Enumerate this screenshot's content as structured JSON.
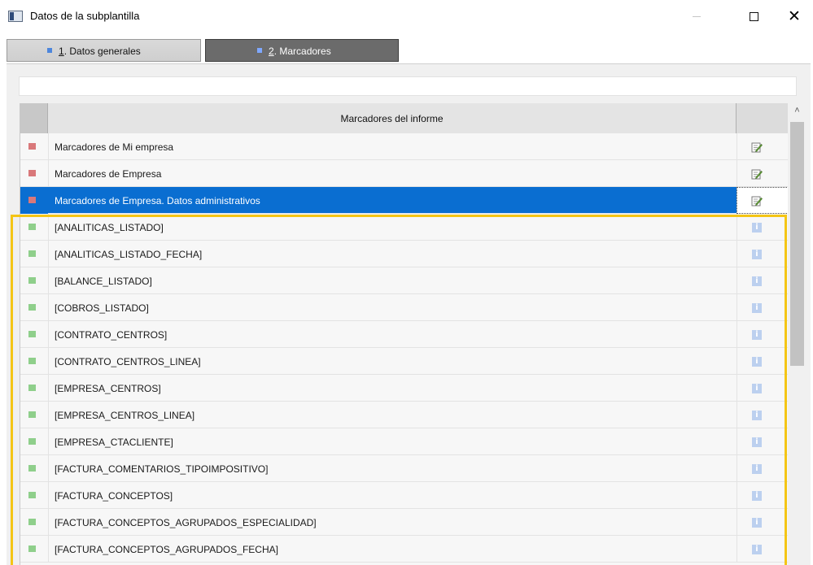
{
  "window": {
    "title": "Datos de la subplantilla",
    "minimize_label": "minimize",
    "maximize_label": "maximize",
    "close_label": "close"
  },
  "tabs": [
    {
      "number": "1",
      "rest": ". Datos generales",
      "active": false
    },
    {
      "number": "2",
      "rest": ". Marcadores",
      "active": true
    }
  ],
  "filter": {
    "value": "",
    "placeholder": ""
  },
  "grid": {
    "header": "Marcadores del informe",
    "rows": [
      {
        "label": "Marcadores de Mi empresa",
        "marker": "red",
        "action": "edit-icon"
      },
      {
        "label": "Marcadores de Empresa",
        "marker": "red",
        "action": "edit-icon"
      },
      {
        "label": "Marcadores de Empresa. Datos administrativos",
        "marker": "red",
        "action": "edit-icon",
        "selected": true
      },
      {
        "label": "[ANALITICAS_LISTADO]",
        "marker": "green",
        "action": "info-icon"
      },
      {
        "label": "[ANALITICAS_LISTADO_FECHA]",
        "marker": "green",
        "action": "info-icon"
      },
      {
        "label": "[BALANCE_LISTADO]",
        "marker": "green",
        "action": "info-icon"
      },
      {
        "label": "[COBROS_LISTADO]",
        "marker": "green",
        "action": "info-icon"
      },
      {
        "label": "[CONTRATO_CENTROS]",
        "marker": "green",
        "action": "info-icon"
      },
      {
        "label": "[CONTRATO_CENTROS_LINEA]",
        "marker": "green",
        "action": "info-icon"
      },
      {
        "label": "[EMPRESA_CENTROS]",
        "marker": "green",
        "action": "info-icon"
      },
      {
        "label": "[EMPRESA_CENTROS_LINEA]",
        "marker": "green",
        "action": "info-icon"
      },
      {
        "label": "[EMPRESA_CTACLIENTE]",
        "marker": "green",
        "action": "info-icon"
      },
      {
        "label": "[FACTURA_COMENTARIOS_TIPOIMPOSITIVO]",
        "marker": "green",
        "action": "info-icon"
      },
      {
        "label": "[FACTURA_CONCEPTOS]",
        "marker": "green",
        "action": "info-icon"
      },
      {
        "label": "[FACTURA_CONCEPTOS_AGRUPADOS_ESPECIALIDAD]",
        "marker": "green",
        "action": "info-icon"
      },
      {
        "label": "[FACTURA_CONCEPTOS_AGRUPADOS_FECHA]",
        "marker": "green",
        "action": "info-icon"
      }
    ]
  },
  "info_glyph": "i",
  "colors": {
    "selected_row": "#0a6ed1",
    "highlight_border": "#f4c515",
    "marker_red": "#d9787a",
    "marker_green": "#8fcf8b"
  }
}
